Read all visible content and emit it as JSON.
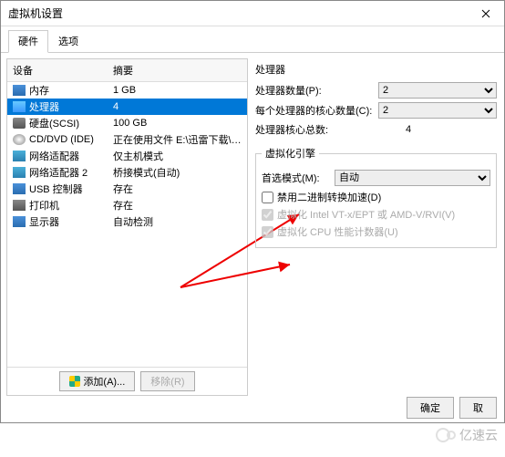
{
  "window": {
    "title": "虚拟机设置"
  },
  "tabs": {
    "hardware": "硬件",
    "options": "选项"
  },
  "columns": {
    "device": "设备",
    "summary": "摘要"
  },
  "devices": [
    {
      "name": "内存",
      "summary": "1 GB",
      "icon": "ic-mem"
    },
    {
      "name": "处理器",
      "summary": "4",
      "icon": "ic-cpu",
      "selected": true
    },
    {
      "name": "硬盘(SCSI)",
      "summary": "100 GB",
      "icon": "ic-disk"
    },
    {
      "name": "CD/DVD (IDE)",
      "summary": "正在使用文件 E:\\迅雷下载\\CentOS-...",
      "icon": "ic-cd"
    },
    {
      "name": "网络适配器",
      "summary": "仅主机模式",
      "icon": "ic-net"
    },
    {
      "name": "网络适配器 2",
      "summary": "桥接模式(自动)",
      "icon": "ic-net"
    },
    {
      "name": "USB 控制器",
      "summary": "存在",
      "icon": "ic-usb"
    },
    {
      "name": "打印机",
      "summary": "存在",
      "icon": "ic-print"
    },
    {
      "name": "显示器",
      "summary": "自动检测",
      "icon": "ic-disp"
    }
  ],
  "processor": {
    "section_label": "处理器",
    "count_label": "处理器数量(P):",
    "count_value": "2",
    "cores_label": "每个处理器的核心数量(C):",
    "cores_value": "2",
    "total_label": "处理器核心总数:",
    "total_value": "4"
  },
  "virtualization": {
    "legend": "虚拟化引擎",
    "pref_label": "首选模式(M):",
    "pref_value": "自动",
    "disable_binary": "禁用二进制转换加速(D)",
    "vt_label": "虚拟化 Intel VT-x/EPT 或 AMD-V/RVI(V)",
    "perf_label": "虚拟化 CPU 性能计数器(U)"
  },
  "buttons": {
    "add": "添加(A)...",
    "remove": "移除(R)",
    "ok": "确定",
    "cancel": "取"
  },
  "watermark": "亿速云"
}
